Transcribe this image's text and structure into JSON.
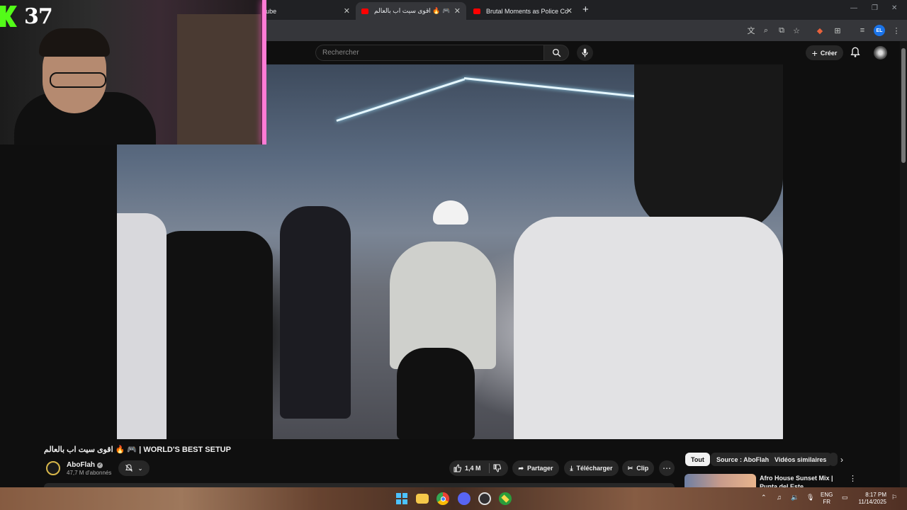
{
  "browser": {
    "tabs": [
      {
        "label": "Tube",
        "active": false
      },
      {
        "label": "اقوى سيت اب بالعالم 🔥 🎮",
        "active": true
      },
      {
        "label": "Brutal Moments as Police Conf",
        "active": false
      }
    ],
    "close_glyph": "✕",
    "new_tab_glyph": "+",
    "profile_initials": "EL"
  },
  "youtube": {
    "search_placeholder": "Rechercher",
    "create_label": "Créer",
    "video": {
      "title": "اقوى سيت اب بالعالم 🔥 🎮 | WORLD'S BEST SETUP",
      "channel": "AboFlah",
      "subscribers": "47,7 M d'abonnés",
      "likes": "1,4 M",
      "actions": {
        "share": "Partager",
        "download": "Télécharger",
        "clip": "Clip"
      }
    },
    "chips": [
      "Tout",
      "Source : AboFlah",
      "Vidéos similaires"
    ],
    "recommended": [
      {
        "title": "Afro House Sunset Mix | Punta del Este"
      }
    ]
  },
  "stream_overlay": {
    "viewer_count": "37"
  },
  "taskbar": {
    "language_top": "ENG",
    "language_bottom": "FR",
    "time": "8:17 PM",
    "date": "11/14/2025"
  },
  "icons": [
    "search-icon",
    "mic-icon",
    "bell-icon",
    "like-icon",
    "dislike-icon",
    "share-icon",
    "download-icon",
    "scissors-icon",
    "more-icon",
    "chevron-right-icon",
    "windows-start-icon",
    "folder-icon",
    "chrome-icon",
    "discord-icon",
    "obs-icon"
  ]
}
